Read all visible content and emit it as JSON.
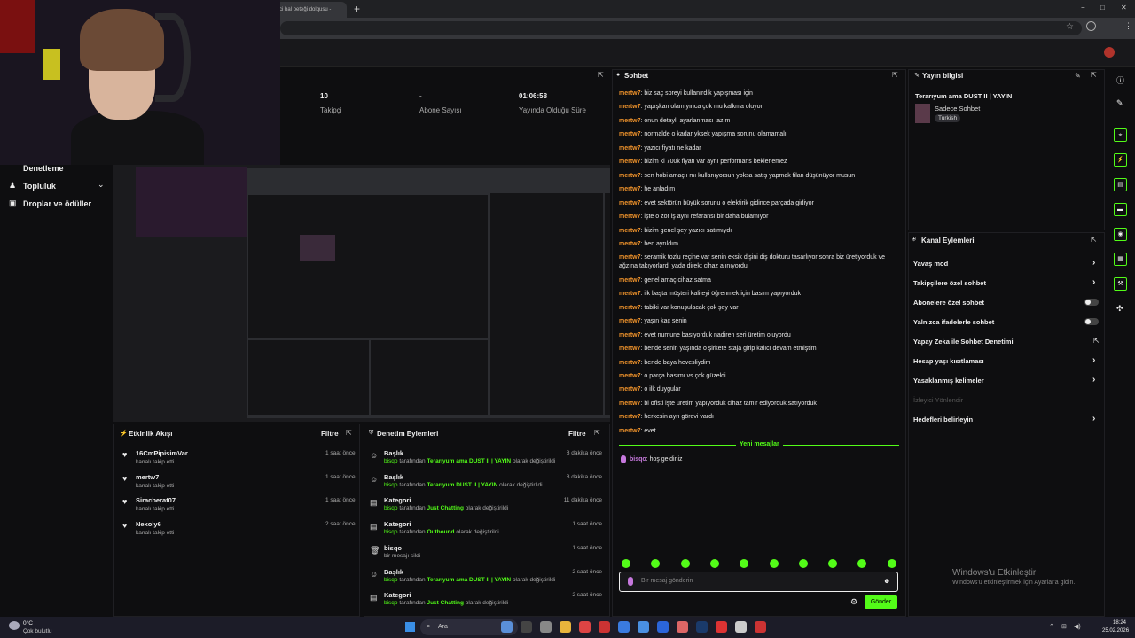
{
  "browser": {
    "tab_title": "ci bal peteği dolgusu - ",
    "new_tab": "+",
    "minimize": "−",
    "maximize": "□",
    "close": "✕"
  },
  "nav": {
    "moderation": "Denetleme",
    "community": "Topluluk",
    "drops": "Droplar ve ödüller"
  },
  "stats": [
    {
      "value": "10",
      "label": "Takipçi"
    },
    {
      "value": "-",
      "label": "Abone Sayısı"
    },
    {
      "value": "01:06:58",
      "label": "Yayında Olduğu Süre"
    }
  ],
  "activity": {
    "title": "Etkinlik Akışı",
    "filter": "Filtre",
    "items": [
      {
        "name": "16CmPipisimVar",
        "sub": "kanalı takip etti",
        "time": "1 saat önce"
      },
      {
        "name": "mertw7",
        "sub": "kanalı takip etti",
        "time": "1 saat önce"
      },
      {
        "name": "Siracberat07",
        "sub": "kanalı takip etti",
        "time": "1 saat önce"
      },
      {
        "name": "Nexoly6",
        "sub": "kanalı takip etti",
        "time": "2 saat önce"
      }
    ]
  },
  "modlog": {
    "title": "Denetim Eylemleri",
    "filter": "Filtre",
    "items": [
      {
        "kind": "Başlık",
        "user": "bisqo",
        "mid": "tarafından",
        "value": "Terarıyum ama DUST II | YAYIN",
        "end": "olarak değiştirildi",
        "time": "8 dakika önce",
        "icon": "user-edit-icon"
      },
      {
        "kind": "Başlık",
        "user": "bisqo",
        "mid": "tarafından",
        "value": "Terarıyum DUST II | YAYIN",
        "end": "olarak değiştirildi",
        "time": "8 dakika önce",
        "icon": "user-edit-icon"
      },
      {
        "kind": "Kategori",
        "user": "bisqo",
        "mid": "tarafından",
        "value": "Just Chatting",
        "end": "olarak değiştirildi",
        "time": "11 dakika önce",
        "icon": "category-icon"
      },
      {
        "kind": "Kategori",
        "user": "bisqo",
        "mid": "tarafından",
        "value": "Outbound",
        "end": "olarak değiştirildi",
        "time": "1 saat önce",
        "icon": "category-icon"
      },
      {
        "kind": "bisqo",
        "user": "",
        "mid": "bir mesajı sildi",
        "value": "",
        "end": "",
        "time": "1 saat önce",
        "icon": "trash-icon"
      },
      {
        "kind": "Başlık",
        "user": "bisqo",
        "mid": "tarafından",
        "value": "Terarıyum ama DUST II | YAYIN",
        "end": "olarak değiştirildi",
        "time": "2 saat önce",
        "icon": "user-edit-icon"
      },
      {
        "kind": "Kategori",
        "user": "bisqo",
        "mid": "tarafından",
        "value": "Just Chatting",
        "end": "olarak değiştirildi",
        "time": "2 saat önce",
        "icon": "category-icon"
      }
    ]
  },
  "chat": {
    "title": "Sohbet",
    "new_messages": "Yeni mesajlar",
    "placeholder": "Bir mesaj gönderin",
    "send": "Gönder",
    "messages": [
      {
        "u": "mertw7",
        "t": "biz saç spreyi kullanırdık yapışması için"
      },
      {
        "u": "mertw7",
        "t": "yapışkan olamıyınca çok mu kalkma oluyor"
      },
      {
        "u": "mertw7",
        "t": "onun detaylı ayarlanması lazım"
      },
      {
        "u": "mertw7",
        "t": "normalde o kadar yksek yapışma sorunu olamamalı"
      },
      {
        "u": "mertw7",
        "t": "yazıcı fiyatı ne kadar"
      },
      {
        "u": "mertw7",
        "t": "bizim ki 700k fiyatı var aynı performans beklenemez"
      },
      {
        "u": "mertw7",
        "t": "sen hobi amaçlı mı kullanıyorsun yoksa satış yapmak filan düşünüyor musun"
      },
      {
        "u": "mertw7",
        "t": "he anladım"
      },
      {
        "u": "mertw7",
        "t": "evet sektörün büyük sorunu o elektirik gidince parçada gidiyor"
      },
      {
        "u": "mertw7",
        "t": "işte o zor iş aynı refaransı bir daha bulamıyor"
      },
      {
        "u": "mertw7",
        "t": "bizim genel şey yazıcı satımıydı"
      },
      {
        "u": "mertw7",
        "t": "ben ayrıldım"
      },
      {
        "u": "mertw7",
        "t": "seramik tozlu reçine var senin eksik dişini diş dokturu tasarlıyor sonra biz üretiyorduk ve ağzına takıyorlardı yada direkt cihaz alınıyordu"
      },
      {
        "u": "mertw7",
        "t": "genel amaç cihaz satma"
      },
      {
        "u": "mertw7",
        "t": "ilk başta müşteri kaliteyi öğrenmek için basım yapıyorduk"
      },
      {
        "u": "mertw7",
        "t": "tabiki var konuşulacak çok şey var"
      },
      {
        "u": "mertw7",
        "t": "yaşın kaç senin"
      },
      {
        "u": "mertw7",
        "t": "evet numune basıyorduk nadiren seri üretim oluyordu"
      },
      {
        "u": "mertw7",
        "t": "bende senin yaşında o şirkete staja girip kalıcı devam etmiştim"
      },
      {
        "u": "mertw7",
        "t": "bende baya hevesliydim"
      },
      {
        "u": "mertw7",
        "t": "o parça basımı vs çok güzeldi"
      },
      {
        "u": "mertw7",
        "t": "o ilk duygular"
      },
      {
        "u": "mertw7",
        "t": "bi ofisti işte üretim yapıyorduk cihaz tamir ediyorduk satıyorduk"
      },
      {
        "u": "mertw7",
        "t": "herkesin ayrı görevi vardı"
      },
      {
        "u": "mertw7",
        "t": "evet"
      }
    ],
    "after": {
      "u": "bisqo",
      "t": "hoş geldiniz"
    }
  },
  "stream_info": {
    "title": "Yayın bilgisi",
    "stream_title": "Terarıyum ama DUST II | YAYIN",
    "category": "Sadece Sohbet",
    "language": "Turkish"
  },
  "channel_actions": {
    "title": "Kanal Eylemleri",
    "items": [
      {
        "label": "Yavaş mod",
        "ctrl": "chevron"
      },
      {
        "label": "Takipçilere özel sohbet",
        "ctrl": "chevron"
      },
      {
        "label": "Abonelere özel sohbet",
        "ctrl": "toggle"
      },
      {
        "label": "Yalnızca ifadelerle sohbet",
        "ctrl": "toggle"
      },
      {
        "label": "Yapay Zeka ile Sohbet Denetimi",
        "ctrl": "ext"
      },
      {
        "label": "Hesap yaşı kısıtlaması",
        "ctrl": "chevron"
      },
      {
        "label": "Yasaklanmış kelimeler",
        "ctrl": "chevron"
      },
      {
        "label": "İzleyici Yönlendir",
        "ctrl": "none",
        "disabled": true
      },
      {
        "label": "Hedefleri belirleyin",
        "ctrl": "chevron"
      }
    ]
  },
  "watermark": {
    "line1": "Windows'u Etkinleştir",
    "line2": "Windows'u etkinleştirmek için Ayarlar'a gidin."
  },
  "taskbar": {
    "temp": "0°C",
    "weather": "Çok bulutlu",
    "search": "Ara",
    "time": "18:24",
    "date": "25.02.2026"
  },
  "colors": {
    "accent": "#53fc18",
    "chat_user": "#f0932b",
    "bisqo": "#c678dd"
  }
}
